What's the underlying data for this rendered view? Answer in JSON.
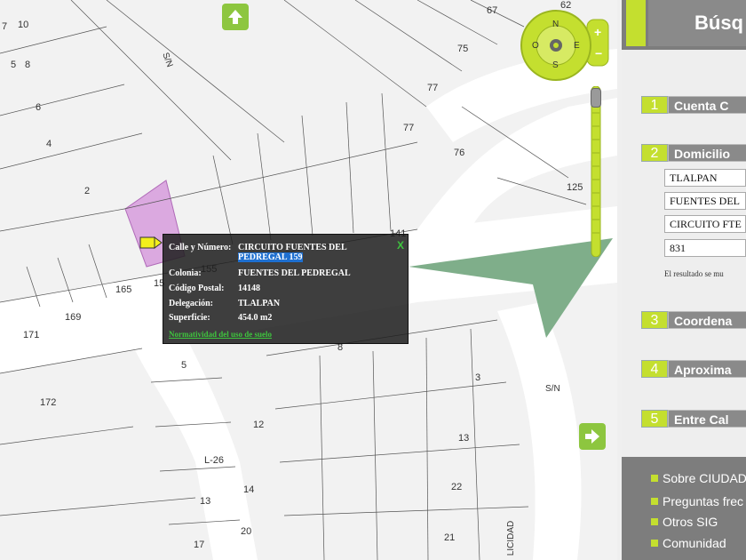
{
  "map": {
    "lot_numbers": [
      {
        "id": "lot-7",
        "text": "7"
      },
      {
        "id": "lot-10",
        "text": "10"
      },
      {
        "id": "lot-5",
        "text": "5"
      },
      {
        "id": "lot-8",
        "text": "8"
      },
      {
        "id": "lot-6",
        "text": "6"
      },
      {
        "id": "lot-4",
        "text": "4"
      },
      {
        "id": "lot-2",
        "text": "2"
      },
      {
        "id": "lot-165",
        "text": "165"
      },
      {
        "id": "lot-169",
        "text": "169"
      },
      {
        "id": "lot-171",
        "text": "171"
      },
      {
        "id": "lot-172",
        "text": "172"
      },
      {
        "id": "lot-5b",
        "text": "5"
      },
      {
        "id": "lot-67",
        "text": "67"
      },
      {
        "id": "lot-62",
        "text": "62"
      },
      {
        "id": "lot-75",
        "text": "75"
      },
      {
        "id": "lot-77a",
        "text": "77"
      },
      {
        "id": "lot-77b",
        "text": "77"
      },
      {
        "id": "lot-76",
        "text": "76"
      },
      {
        "id": "lot-125",
        "text": "125"
      },
      {
        "id": "lot-141",
        "text": "141"
      },
      {
        "id": "lot-155",
        "text": "155"
      },
      {
        "id": "lot-15x",
        "text": "15"
      },
      {
        "id": "lot-8b",
        "text": "8"
      },
      {
        "id": "lot-3",
        "text": "3"
      },
      {
        "id": "lot-12",
        "text": "12"
      },
      {
        "id": "lot-13a",
        "text": "13"
      },
      {
        "id": "lot-22",
        "text": "22"
      },
      {
        "id": "lot-l26",
        "text": "L-26"
      },
      {
        "id": "lot-14",
        "text": "14"
      },
      {
        "id": "lot-13b",
        "text": "13"
      },
      {
        "id": "lot-17",
        "text": "17"
      },
      {
        "id": "lot-20",
        "text": "20"
      },
      {
        "id": "lot-21",
        "text": "21"
      }
    ],
    "street_names": {
      "sn_top": "S/N",
      "sn_right": "S/N",
      "felicidad": "LICIDAD"
    },
    "compass": {
      "n": "N",
      "s": "S",
      "e": "E",
      "o": "O",
      "plus": "+",
      "minus": "−"
    },
    "colors": {
      "accent": "#c4df2f",
      "park": "#7fae8a",
      "selected_lot": "#dba9e0"
    }
  },
  "info_popup": {
    "rows": [
      {
        "label": "Calle y Número:",
        "value_line1": "CIRCUITO FUENTES DEL",
        "value_line2": "PEDREGAL 159"
      },
      {
        "label": "Colonia:",
        "value": "FUENTES DEL PEDREGAL"
      },
      {
        "label": "Código Postal:",
        "value": "14148"
      },
      {
        "label": "Delegación:",
        "value": "TLALPAN"
      },
      {
        "label": "Superficie:",
        "value": "454.0 m2"
      }
    ],
    "link": "Normatividad del uso de suelo",
    "close": "X"
  },
  "panel": {
    "title": "Búsq",
    "steps": [
      {
        "num": "1",
        "label": "Cuenta C"
      },
      {
        "num": "2",
        "label": "Domicilio"
      },
      {
        "num": "3",
        "label": "Coordena"
      },
      {
        "num": "4",
        "label": "Aproxima"
      },
      {
        "num": "5",
        "label": "Entre Cal"
      }
    ],
    "fields": [
      "TLALPAN",
      "FUENTES DEL",
      "CIRCUITO FTE",
      "831"
    ],
    "note": "El resultado se mu",
    "footer": [
      "Sobre CIUDAD",
      "Preguntas frec",
      "Otros SIG",
      "Comunidad"
    ]
  }
}
